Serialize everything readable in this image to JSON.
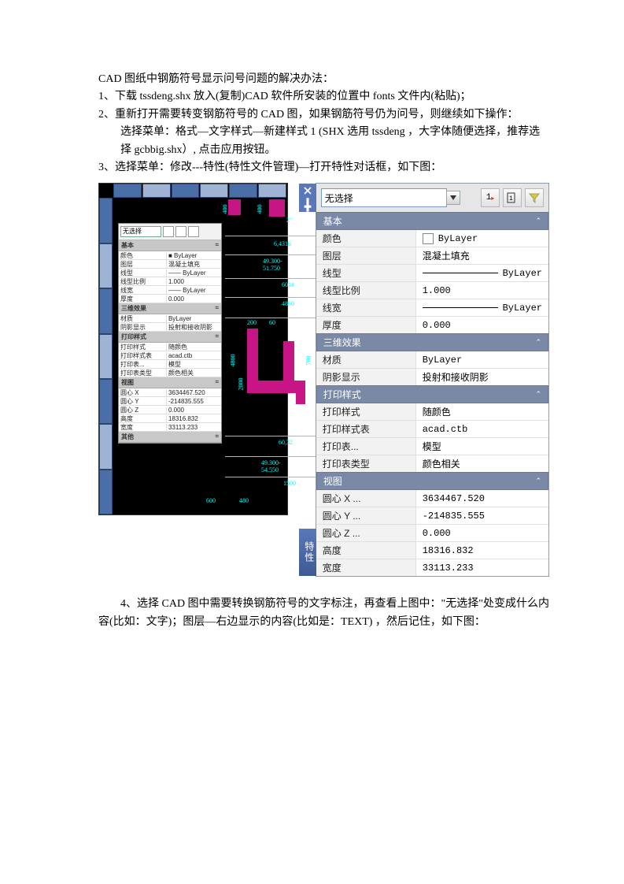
{
  "doc": {
    "title_line": "CAD 图纸中钢筋符号显示问号问题的解决办法：",
    "step1": "1、下载 tssdeng.shx  放入(复制)CAD 软件所安装的位置中 fonts 文件内(粘贴)；",
    "step2": "2、重新打开需要转变钢筋符号的 CAD 图，如果钢筋符号仍为问号，则继续如下操作：",
    "step2a": "选择菜单：格式—文字样式—新建样式 1    (SHX 选用 tssdeng ，大字体随便选择，推荐选择 gcbbig.shx）, 点击应用按钮。",
    "step3": "3、选择菜单：修改---特性(特性文件管理)—打开特性对话框，如下图：",
    "step4": "4、选择 CAD 图中需要转换钢筋符号的文字标注，再查看上图中：\"无选择\"处变成什么内容(比如：文字)；图层—右边显示的内容(比如是：TEXT)  ，然后记住，如下图："
  },
  "cad_left": {
    "sel": "无选择",
    "sections": {
      "basic": "基本",
      "threed": "三维效果",
      "print": "打印样式",
      "view": "视图"
    },
    "rows": {
      "color_k": "颜色",
      "color_v": "■ ByLayer",
      "layer_k": "图层",
      "layer_v": "混凝土填充",
      "ltype_k": "线型",
      "ltype_v": "—— ByLayer",
      "lscale_k": "线型比例",
      "lscale_v": "1.000",
      "lwt_k": "线宽",
      "lwt_v": "—— ByLayer",
      "th_k": "厚度",
      "th_v": "0.000",
      "mat_k": "材质",
      "mat_v": "ByLayer",
      "shadow_k": "阴影显示",
      "shadow_v": "投射和接收阴影",
      "ps_k": "打印样式",
      "ps_v": "随颜色",
      "pst_k": "打印样式表",
      "pst_v": "acad.ctb",
      "pstt_k": "打印表...",
      "pstt_v": "模型",
      "pstty_k": "打印表类型",
      "pstty_v": "颜色相关",
      "cx_k": "圆心 X",
      "cx_v": "3634467.520",
      "cy_k": "圆心 Y",
      "cy_v": "-214835.555",
      "cz_k": "圆心 Z",
      "cz_v": "0.000",
      "h_k": "高度",
      "h_v": "18316.832",
      "w_k": "宽度",
      "w_v": "33113.233"
    },
    "dims": {
      "d400a": "400",
      "d400b": "400",
      "d2": "2\"",
      "d6431": "6,4316",
      "d49": "49.300-51.750",
      "d6014": "601#",
      "d4860": "4860",
      "d200": "200",
      "d60": "60",
      "d700": "700",
      "d4800": "4800",
      "d2000": "2000",
      "d6032": "60,32",
      "d4930": "49.300-54.550",
      "d1500": "1500",
      "d480": "480",
      "d600": "600"
    },
    "bottom_label": "其他"
  },
  "props": {
    "sidebar_label": "特性",
    "select_value": "无选择",
    "toolbar": {
      "btn1": "1",
      "btn2": "1"
    },
    "sections": {
      "basic": "基本",
      "threed": "三维效果",
      "print": "打印样式",
      "view": "视图"
    },
    "basic": [
      {
        "k": "颜色",
        "v": "ByLayer",
        "swatch": true
      },
      {
        "k": "图层",
        "v": "混凝土填充"
      },
      {
        "k": "线型",
        "v": "ByLayer",
        "line": true
      },
      {
        "k": "线型比例",
        "v": "1.000"
      },
      {
        "k": "线宽",
        "v": "ByLayer",
        "line": true
      },
      {
        "k": "厚度",
        "v": "0.000"
      }
    ],
    "threed": [
      {
        "k": "材质",
        "v": "ByLayer"
      },
      {
        "k": "阴影显示",
        "v": "投射和接收阴影"
      }
    ],
    "print": [
      {
        "k": "打印样式",
        "v": "随颜色"
      },
      {
        "k": "打印样式表",
        "v": "acad.ctb"
      },
      {
        "k": "打印表...",
        "v": "模型"
      },
      {
        "k": "打印表类型",
        "v": "颜色相关"
      }
    ],
    "view": [
      {
        "k": "圆心 X ...",
        "v": "3634467.520"
      },
      {
        "k": "圆心 Y ...",
        "v": "-214835.555"
      },
      {
        "k": "圆心 Z ...",
        "v": "0.000"
      },
      {
        "k": "高度",
        "v": "18316.832"
      },
      {
        "k": "宽度",
        "v": "33113.233"
      }
    ]
  }
}
